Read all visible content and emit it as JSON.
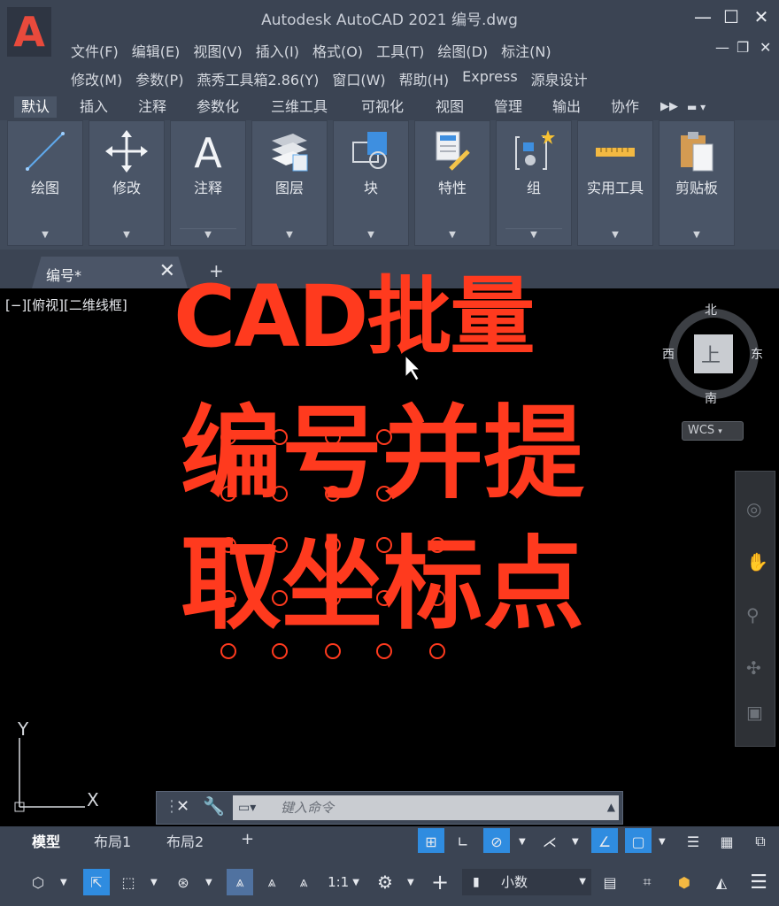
{
  "window": {
    "title": "Autodesk AutoCAD 2021    编号.dwg",
    "minimize": "—",
    "maximize": "☐",
    "close": "✕"
  },
  "logo_letter": "A",
  "menu_row_1": [
    "文件(F)",
    "编辑(E)",
    "视图(V)",
    "插入(I)",
    "格式(O)",
    "工具(T)",
    "绘图(D)",
    "标注(N)"
  ],
  "menu_row_2": [
    "修改(M)",
    "参数(P)",
    "燕秀工具箱2.86(Y)",
    "窗口(W)",
    "帮助(H)",
    "Express",
    "源泉设计"
  ],
  "ribbon_tabs": [
    "默认",
    "插入",
    "注释",
    "参数化",
    "三维工具",
    "可视化",
    "视图",
    "管理",
    "输出",
    "协作"
  ],
  "ribbon_panels": [
    {
      "label": "绘图",
      "icon": "line-icon"
    },
    {
      "label": "修改",
      "icon": "move-icon"
    },
    {
      "label": "注释",
      "icon": "text-icon"
    },
    {
      "label": "图层",
      "icon": "layers-icon"
    },
    {
      "label": "块",
      "icon": "block-icon"
    },
    {
      "label": "特性",
      "icon": "properties-icon"
    },
    {
      "label": "组",
      "icon": "group-icon"
    },
    {
      "label": "实用工具",
      "icon": "measure-icon"
    },
    {
      "label": "剪贴板",
      "icon": "clipboard-icon"
    }
  ],
  "file_tab": {
    "label": "编号*",
    "close": "✕",
    "new": "+"
  },
  "viewport_label": "[−][俯视][二维线框]",
  "overlay": {
    "line1": "CAD批量",
    "line2": "编号并提",
    "line3": "取坐标点"
  },
  "viewcube": {
    "north": "北",
    "south": "南",
    "east": "东",
    "west": "西",
    "face": "上",
    "wcs": "WCS"
  },
  "ucs": {
    "y": "Y",
    "x": "X"
  },
  "command": {
    "placeholder": "键入命令"
  },
  "layout_tabs": [
    "模型",
    "布局1",
    "布局2"
  ],
  "layout_add": "+",
  "status": {
    "scale": "1:1",
    "units": "小数"
  },
  "colors": {
    "accent": "#2f8ce0",
    "overlay_text": "#ff3a1e",
    "chrome": "#3b4453",
    "canvas": "#000000"
  }
}
